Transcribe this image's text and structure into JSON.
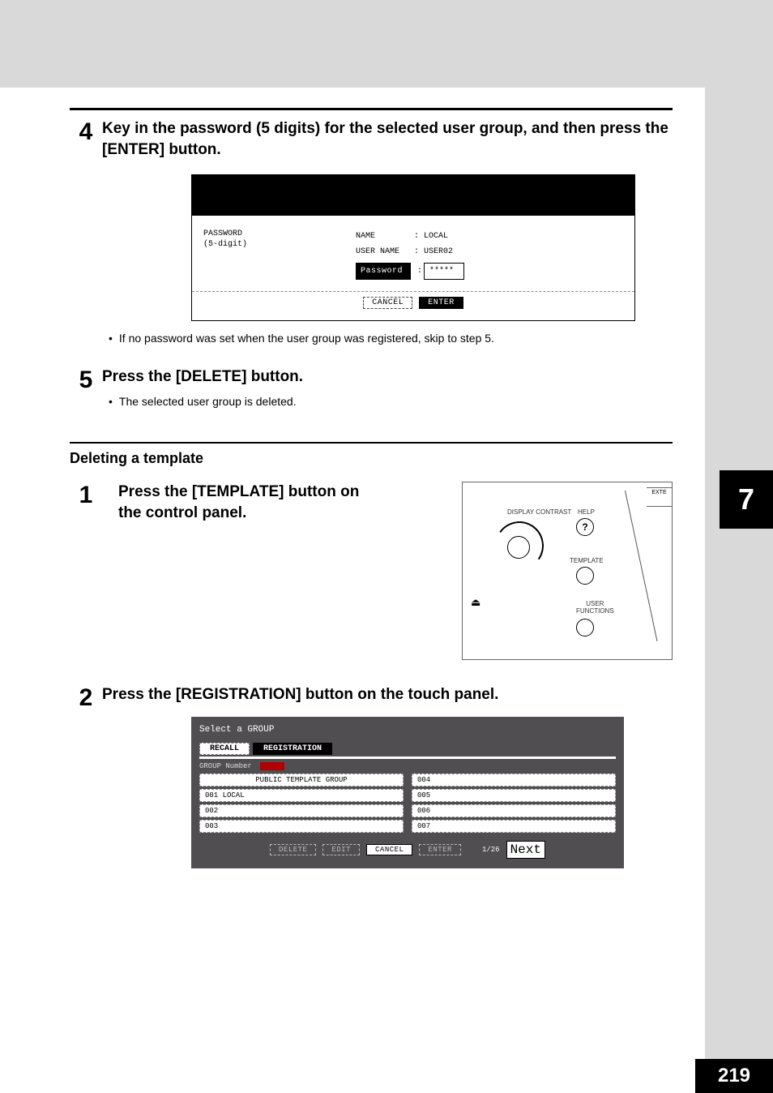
{
  "page": {
    "side_tab": "7",
    "number": "219"
  },
  "steps": {
    "s4": {
      "num": "4",
      "title": "Key in the password (5 digits) for the selected user group, and then press the [ENTER] button.",
      "note": "If no password was set when the user group was registered, skip to step 5."
    },
    "s5": {
      "num": "5",
      "title": "Press the [DELETE] button.",
      "note": "The selected user group is deleted."
    },
    "sub": {
      "title": "Deleting a template"
    },
    "s1b": {
      "num": "1",
      "title": "Press the [TEMPLATE] button on the control panel."
    },
    "s2b": {
      "num": "2",
      "title": "Press the [REGISTRATION] button on the touch panel."
    }
  },
  "screen1": {
    "left1": "PASSWORD",
    "left2": "(5-digit)",
    "name_label": "NAME",
    "name_value": ": LOCAL",
    "user_label": "USER NAME",
    "user_value": ": USER02",
    "pw_label": "Password",
    "pw_sep": ":",
    "pw_value": "*****",
    "cancel": "CANCEL",
    "enter": "ENTER"
  },
  "panel": {
    "exte": "EXTE",
    "contrast": "DISPLAY CONTRAST",
    "help": "HELP",
    "help_icon": "?",
    "template": "TEMPLATE",
    "user_func1": "USER",
    "user_func2": "FUNCTIONS"
  },
  "screen2": {
    "title": "Select a GROUP",
    "tab_recall": "RECALL",
    "tab_reg": "REGISTRATION",
    "group_number": "GROUP Number",
    "cells": [
      "PUBLIC TEMPLATE GROUP",
      "004",
      "001 LOCAL",
      "005",
      "002",
      "006",
      "003",
      "007"
    ],
    "delete": "DELETE",
    "edit": "EDIT",
    "cancel": "CANCEL",
    "enter": "ENTER",
    "next": "Next",
    "page": "1/26"
  }
}
